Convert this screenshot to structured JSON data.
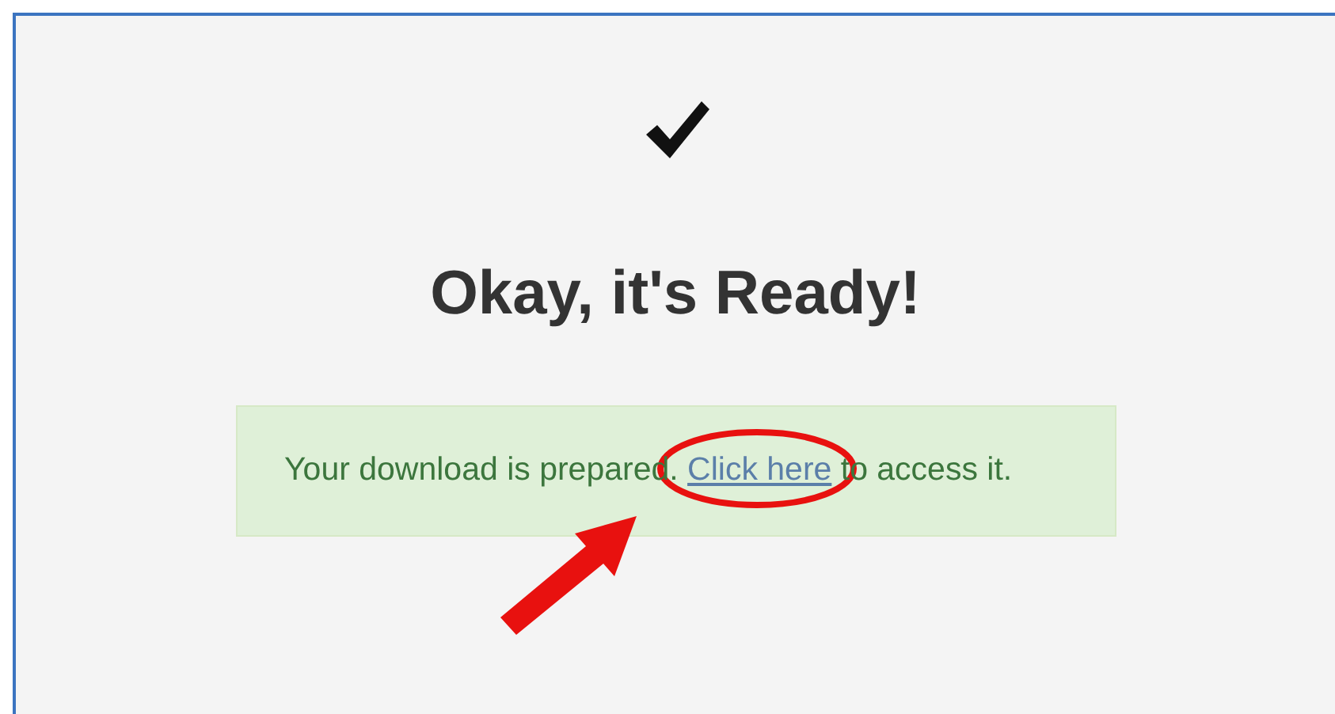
{
  "status_icon": {
    "kind": "check"
  },
  "heading": "Okay, it's Ready!",
  "alert": {
    "text_before": "Your download is prepared.",
    "link": "Click here",
    "text_after": "to access it."
  },
  "highlight_ellipse": {
    "color": "#e8110f"
  },
  "pointer_arrow": {
    "color": "#e8110f"
  }
}
